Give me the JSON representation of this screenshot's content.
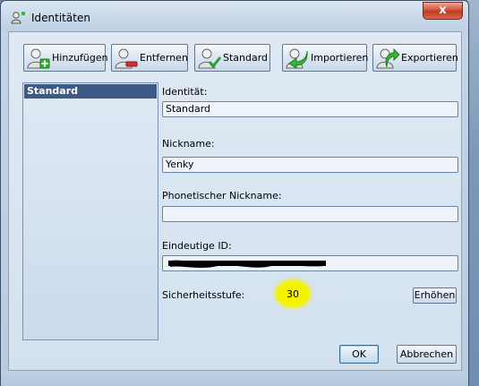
{
  "window": {
    "title": "Identitäten",
    "close_label": "x"
  },
  "toolbar": {
    "add_label": "Hinzufügen",
    "remove_label": "Entfernen",
    "default_label": "Standard",
    "import_label": "Importieren",
    "export_label": "Exportieren"
  },
  "identity_list": {
    "items": [
      {
        "label": "Standard",
        "selected": true
      }
    ]
  },
  "form": {
    "identity_label": "Identität:",
    "identity_value": "Standard",
    "nickname_label": "Nickname:",
    "nickname_value": "Yenky",
    "phonetic_label": "Phonetischer Nickname:",
    "phonetic_value": "",
    "unique_id_label": "Eindeutige ID:",
    "security_label": "Sicherheitsstufe:",
    "security_value": "30",
    "increase_label": "Erhöhen"
  },
  "footer": {
    "ok_label": "OK",
    "cancel_label": "Abbrechen"
  },
  "colors": {
    "selection": "#3d5a86",
    "highlight": "#f4f400",
    "add": "#2bb52b",
    "remove": "#d32f2f"
  }
}
